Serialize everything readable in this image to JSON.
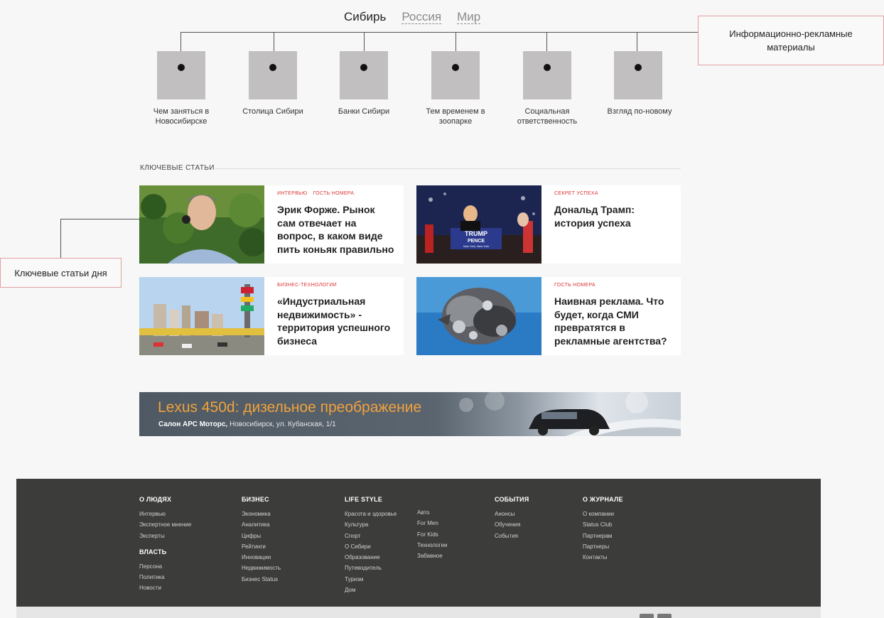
{
  "regions": {
    "tabs": [
      "Сибирь",
      "Россия",
      "Мир"
    ]
  },
  "promo": {
    "annotation_lines": [
      "Информационно-рекламные",
      "материалы"
    ],
    "tiles": [
      {
        "label_lines": [
          "Чем заняться в",
          "Новосибирске"
        ]
      },
      {
        "label_lines": [
          "Столица Сибири"
        ]
      },
      {
        "label_lines": [
          "Банки Сибири"
        ]
      },
      {
        "label_lines": [
          "Тем временем в",
          "зоопарке"
        ]
      },
      {
        "label_lines": [
          "Социальная",
          "ответственность"
        ]
      },
      {
        "label_lines": [
          "Взгляд по-новому"
        ]
      }
    ]
  },
  "key_articles": {
    "section_title": "КЛЮЧЕВЫЕ СТАТЬИ",
    "annotation": "Ключевые статьи дня",
    "cards": [
      {
        "tags": [
          "ИНТЕРВЬЮ",
          "ГОСТЬ НОМЕРА"
        ],
        "headline": "Эрик Форже. Рынок сам отвечает на вопрос, в каком виде пить коньяк правильно"
      },
      {
        "tags": [
          "СЕКРЕТ УСПЕХА"
        ],
        "headline": "Дональд Трамп: история успеха",
        "image_text": {
          "line1": "TRUMP",
          "line2": "PENCE",
          "line3": "New York, New York"
        }
      },
      {
        "tags": [
          "БИЗНЕС-ТЕХНОЛОГИИ"
        ],
        "headline": "«Индустриальная недвижимость» - территория успешного бизнеса"
      },
      {
        "tags": [
          "ГОСТЬ НОМЕРА"
        ],
        "headline": "Наивная реклама. Что будет, когда СМИ превратятся в рекламные агентства?"
      }
    ]
  },
  "ad": {
    "title": "Lexus 450d: дизельное преображение",
    "dealer": "Салон АРС Моторс,",
    "address": " Новосибирск, ул. Кубанская, 1/1"
  },
  "footer": {
    "columns": [
      {
        "title": "О ЛЮДЯХ",
        "links": [
          "Интервью",
          "Экспертное мнение",
          "Эксперты"
        ]
      },
      {
        "title": "ВЛАСТЬ",
        "links": [
          "Персона",
          "Политика",
          "Новости"
        ]
      },
      {
        "title": "БИЗНЕС",
        "links": [
          "Экономика",
          "Аналитика",
          "Цифры",
          "Рейтинги",
          "Инновации",
          "Недвижимость",
          "Бизнес Status"
        ]
      },
      {
        "title": "LIFE STYLE",
        "links": [
          "Красота и здоровье",
          "Культура",
          "Спорт",
          "О Сибири",
          "Образование",
          "Путеводитель",
          "Туризм",
          "Дом"
        ]
      },
      {
        "title": "",
        "links": [
          "Авто",
          "For Men",
          "For Kids",
          "Технологии",
          "Забавное"
        ]
      },
      {
        "title": "СОБЫТИЯ",
        "links": [
          "Анонсы",
          "Обучения",
          "События"
        ]
      },
      {
        "title": "О ЖУРНАЛЕ",
        "links": [
          "О компании",
          "Status Club",
          "Партнерам",
          "Партнеры",
          "Контакты"
        ]
      }
    ]
  },
  "colors": {
    "accent_red": "#d33333",
    "ad_orange": "#f0a23c",
    "footer_bg": "#3c3c3b",
    "tile_gray": "#c2bfc0"
  }
}
